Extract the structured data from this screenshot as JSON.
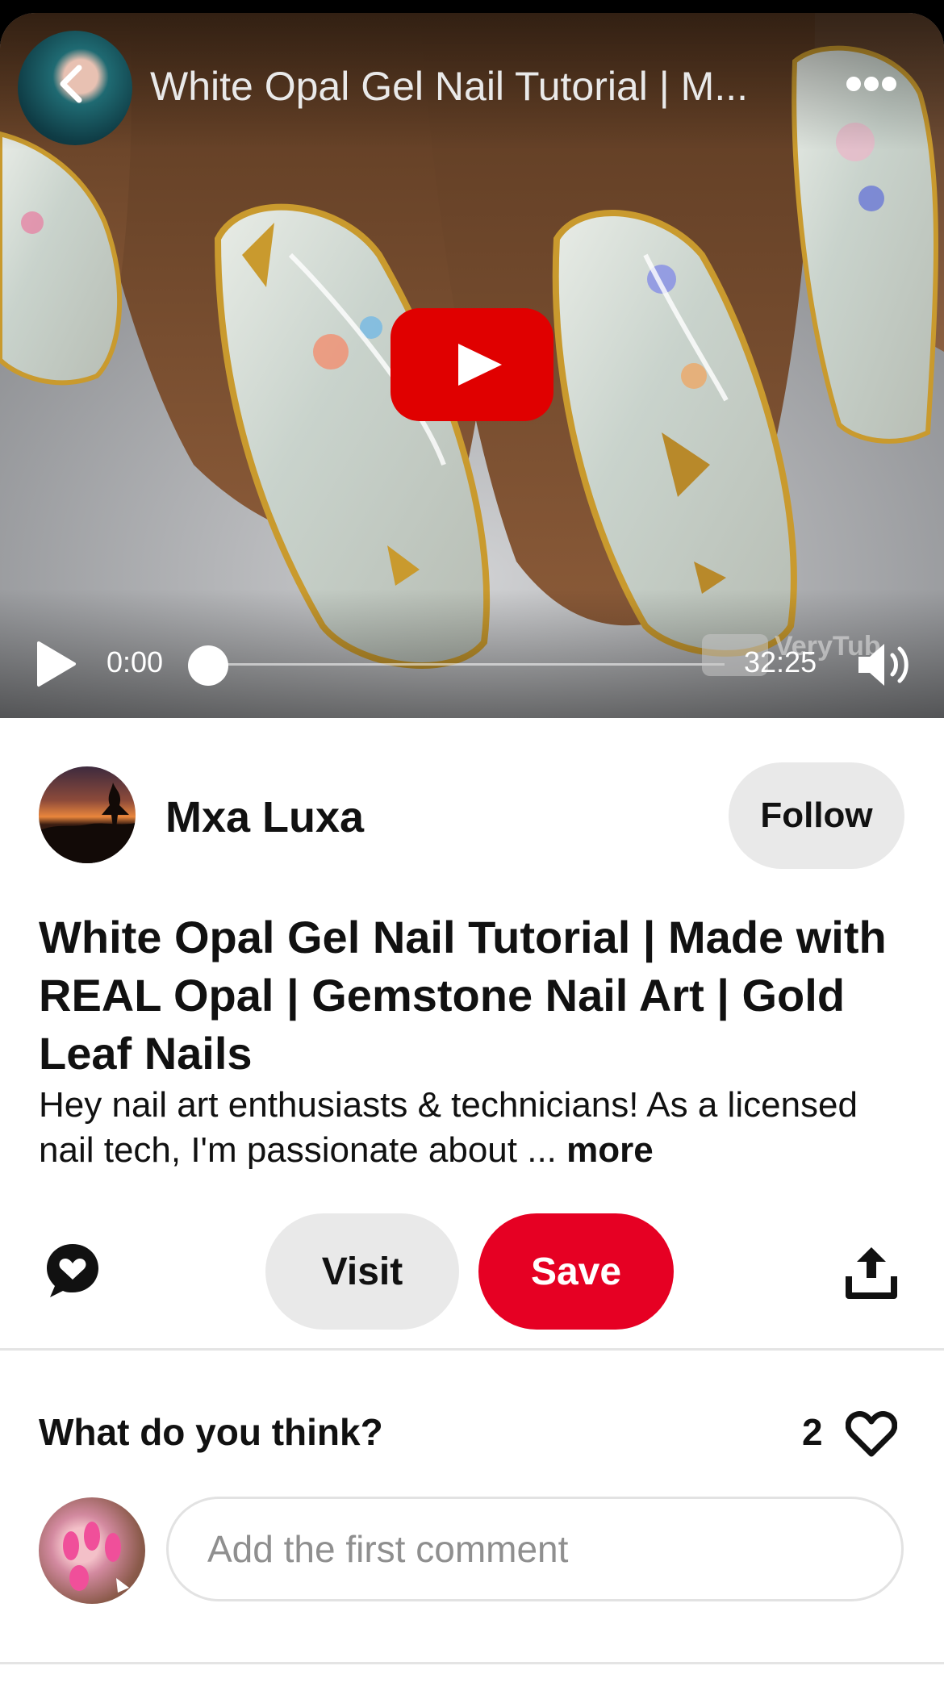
{
  "video": {
    "title": "White Opal Gel Nail Tutorial | M...",
    "current_time": "0:00",
    "duration": "32:25",
    "progress": 0,
    "watermark": "VeryTub"
  },
  "icons": {
    "back": "chevron-left-icon",
    "more": "more-dots-icon",
    "yt_play": "youtube-play-icon",
    "play": "play-icon",
    "volume": "volume-icon",
    "comment": "comment-bubble-icon",
    "share": "share-icon",
    "heart": "heart-icon"
  },
  "creator": {
    "name": "Mxa Luxa",
    "follow_label": "Follow"
  },
  "pin": {
    "title": "White Opal Gel Nail Tutorial | Made with REAL Opal | Gemstone Nail Art | Gold Leaf Nails",
    "description": "Hey nail art enthusiasts & technicians! As a licensed nail tech, I'm passionate about ...",
    "more_label": "more"
  },
  "actions": {
    "visit_label": "Visit",
    "save_label": "Save"
  },
  "comments": {
    "heading": "What do you think?",
    "reaction_count": "2",
    "input_placeholder": "Add the first comment"
  },
  "colors": {
    "save_red": "#e60023",
    "pill_gray": "#e9e9e9",
    "youtube_red": "#e00000"
  }
}
